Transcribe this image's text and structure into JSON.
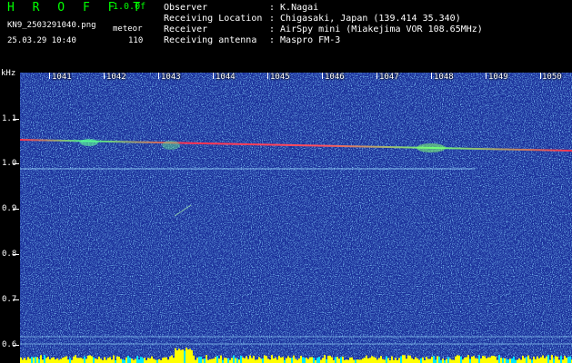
{
  "header": {
    "app_title": "H R O F F T",
    "version": "1.0.0f",
    "filename": "KN9_2503291040.png",
    "datetime": "25.03.29 10:40",
    "meteor_label": "meteor",
    "meteor_count": "110",
    "info": [
      {
        "label": "Observer",
        "value": ": K.Nagai"
      },
      {
        "label": "Receiving Location",
        "value": ": Chigasaki, Japan (139.414 35.340)"
      },
      {
        "label": "Receiver",
        "value": ": AirSpy mini (Miakejima VOR 108.65MHz)"
      },
      {
        "label": "Receiving antenna",
        "value": ": Maspro FM-3"
      }
    ]
  },
  "spectrogram": {
    "y_unit": "kHz",
    "y_labels": [
      "1.1",
      "1.0",
      "0.9",
      "0.8",
      "0.7",
      "0.6"
    ],
    "x_labels": [
      "1041",
      "1042",
      "1043",
      "1044",
      "1045",
      "1046",
      "1047",
      "1048",
      "1049",
      "1050"
    ],
    "colors": {
      "background": "#1a2f9a",
      "noise": "#3fa9ff",
      "signal": "#ff4060",
      "level": "#ffff00"
    }
  }
}
